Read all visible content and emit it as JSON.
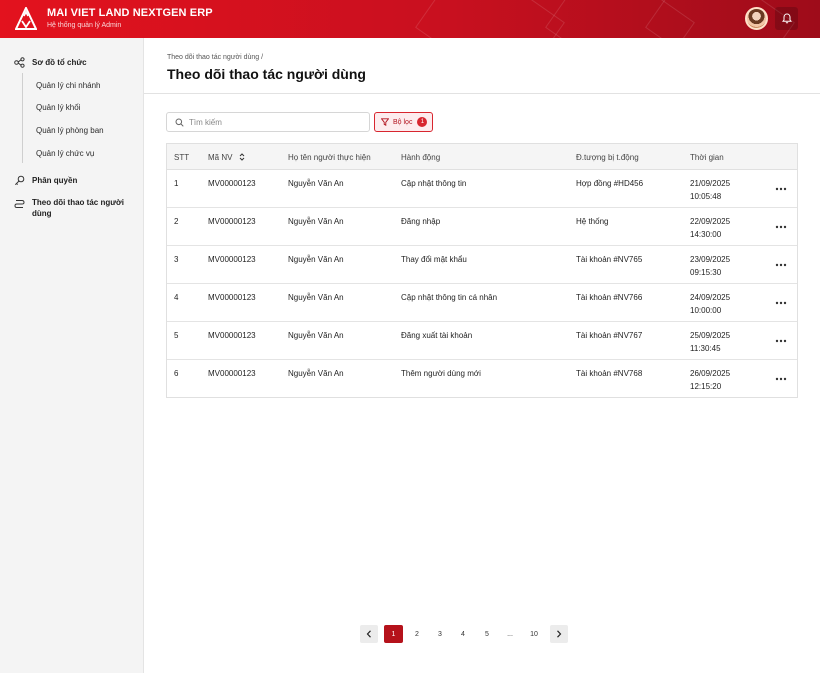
{
  "header": {
    "brand_title": "MAI VIET LAND NEXTGEN ERP",
    "brand_subtitle": "Hệ thống quản lý Admin",
    "logo_icon": "mountain-logo-icon",
    "notification_icon": "bell-icon",
    "brand_color": "#e3121e"
  },
  "sidebar": {
    "groups": [
      {
        "label": "Sơ đồ tổ chức",
        "icon": "org-chart-icon"
      },
      {
        "label": "Phân quyền",
        "icon": "key-icon"
      },
      {
        "label": "Theo dõi thao tác người dùng",
        "icon": "route-icon"
      }
    ],
    "sub_items": [
      "Quản lý chi nhánh",
      "Quản lý khối",
      "Quản lý phòng ban",
      "Quản lý chức vụ"
    ]
  },
  "main": {
    "breadcrumb": "Theo dõi thao tác người dùng /",
    "title": "Theo dõi thao tác người dùng",
    "search_placeholder": "Tìm kiếm",
    "filter_label": "Bộ lọc",
    "filter_count": "1"
  },
  "table": {
    "headers": [
      "STT",
      "Mã NV",
      "Họ tên người thực hiện",
      "Hành động",
      "Đ.tượng bị t.động",
      "Thời gian"
    ],
    "rows": [
      {
        "stt": "1",
        "code": "MV00000123",
        "name": "Nguyễn Văn An",
        "action": "Cập nhật thông tin",
        "target": "Hợp đồng #HD456",
        "date": "21/09/2025",
        "time": "10:05:48"
      },
      {
        "stt": "2",
        "code": "MV00000123",
        "name": "Nguyễn Văn An",
        "action": "Đăng nhập",
        "target": "Hệ thống",
        "date": "22/09/2025",
        "time": "14:30:00"
      },
      {
        "stt": "3",
        "code": "MV00000123",
        "name": "Nguyễn Văn An",
        "action": "Thay đổi mật khẩu",
        "target": "Tài khoản #NV765",
        "date": "23/09/2025",
        "time": "09:15:30"
      },
      {
        "stt": "4",
        "code": "MV00000123",
        "name": "Nguyễn Văn An",
        "action": "Cập nhật thông tin cá nhân",
        "target": "Tài khoản #NV766",
        "date": "24/09/2025",
        "time": "10:00:00"
      },
      {
        "stt": "5",
        "code": "MV00000123",
        "name": "Nguyễn Văn An",
        "action": "Đăng xuất tài khoản",
        "target": "Tài khoản #NV767",
        "date": "25/09/2025",
        "time": "11:30:45"
      },
      {
        "stt": "6",
        "code": "MV00000123",
        "name": "Nguyễn Văn An",
        "action": "Thêm người dùng mới",
        "target": "Tài khoản #NV768",
        "date": "26/09/2025",
        "time": "12:15:20"
      }
    ]
  },
  "pagination": {
    "pages": [
      "1",
      "2",
      "3",
      "4",
      "5",
      "...",
      "10"
    ],
    "active": "1",
    "prev_icon": "chevron-left-icon",
    "next_icon": "chevron-right-icon"
  }
}
